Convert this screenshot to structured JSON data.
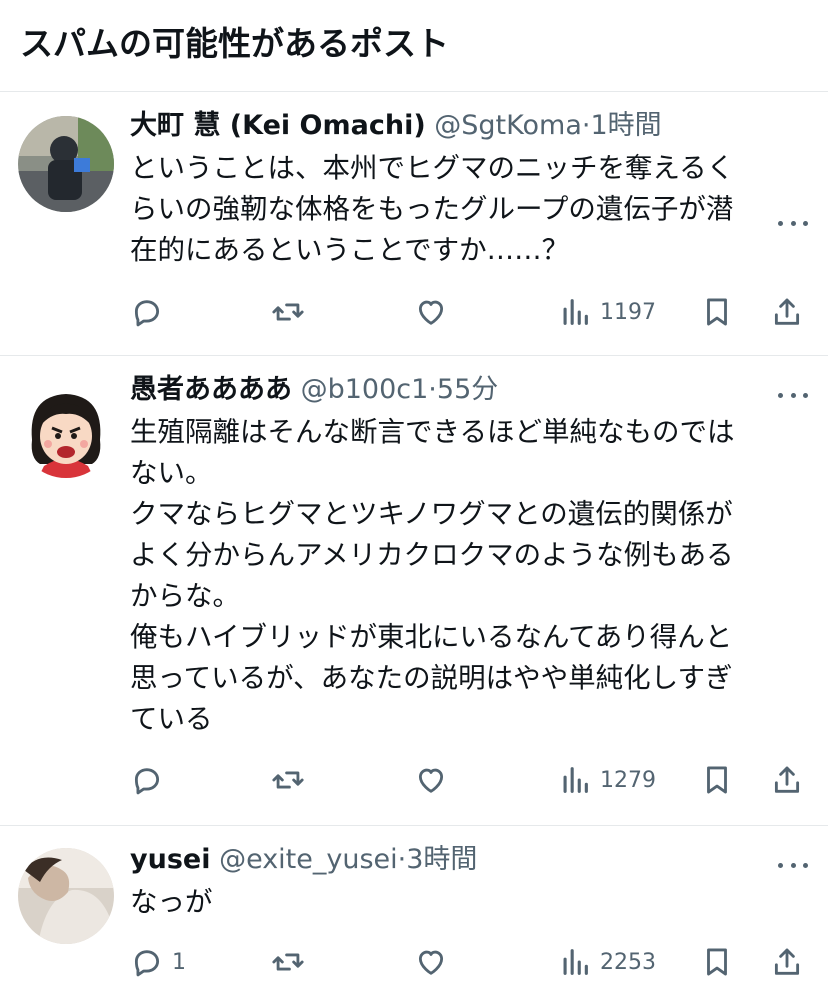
{
  "header": {
    "title": "スパムの可能性があるポスト"
  },
  "posts": [
    {
      "name": "大町 慧 (Kei Omachi)",
      "handle": "@SgtKoma",
      "dot": "·",
      "time": "1時間",
      "text": "ということは、本州でヒグマのニッチを奪えるく\nらいの強靭な体格をもったグループの遺伝子が潜\n在的にあるということですか……？",
      "replies": "",
      "views": "1197",
      "avatar_icon": "person-photo-avatar"
    },
    {
      "name": "愚者ああああ",
      "handle": "@b100c1",
      "dot": "·",
      "time": "55分",
      "text": "生殖隔離はそんな断言できるほど単純なものでは\nない。\nクマならヒグマとツキノワグマとの遺伝的関係が\nよく分からんアメリカクロクマのような例もある\nからな。\n俺もハイブリッドが東北にいるなんてあり得んと\n思っているが、あなたの説明はやや単純化しすぎ\nている",
      "replies": "",
      "views": "1279",
      "avatar_icon": "angry-woman-illustration-avatar"
    },
    {
      "name": "yusei",
      "handle": "@exite_yusei",
      "dot": "·",
      "time": "3時間",
      "text": "なっが",
      "replies": "1",
      "views": "2253",
      "avatar_icon": "person-photo-avatar"
    }
  ],
  "colors": {
    "text": "#0f1419",
    "secondary": "#536471",
    "divider": "#e6e9eb"
  }
}
